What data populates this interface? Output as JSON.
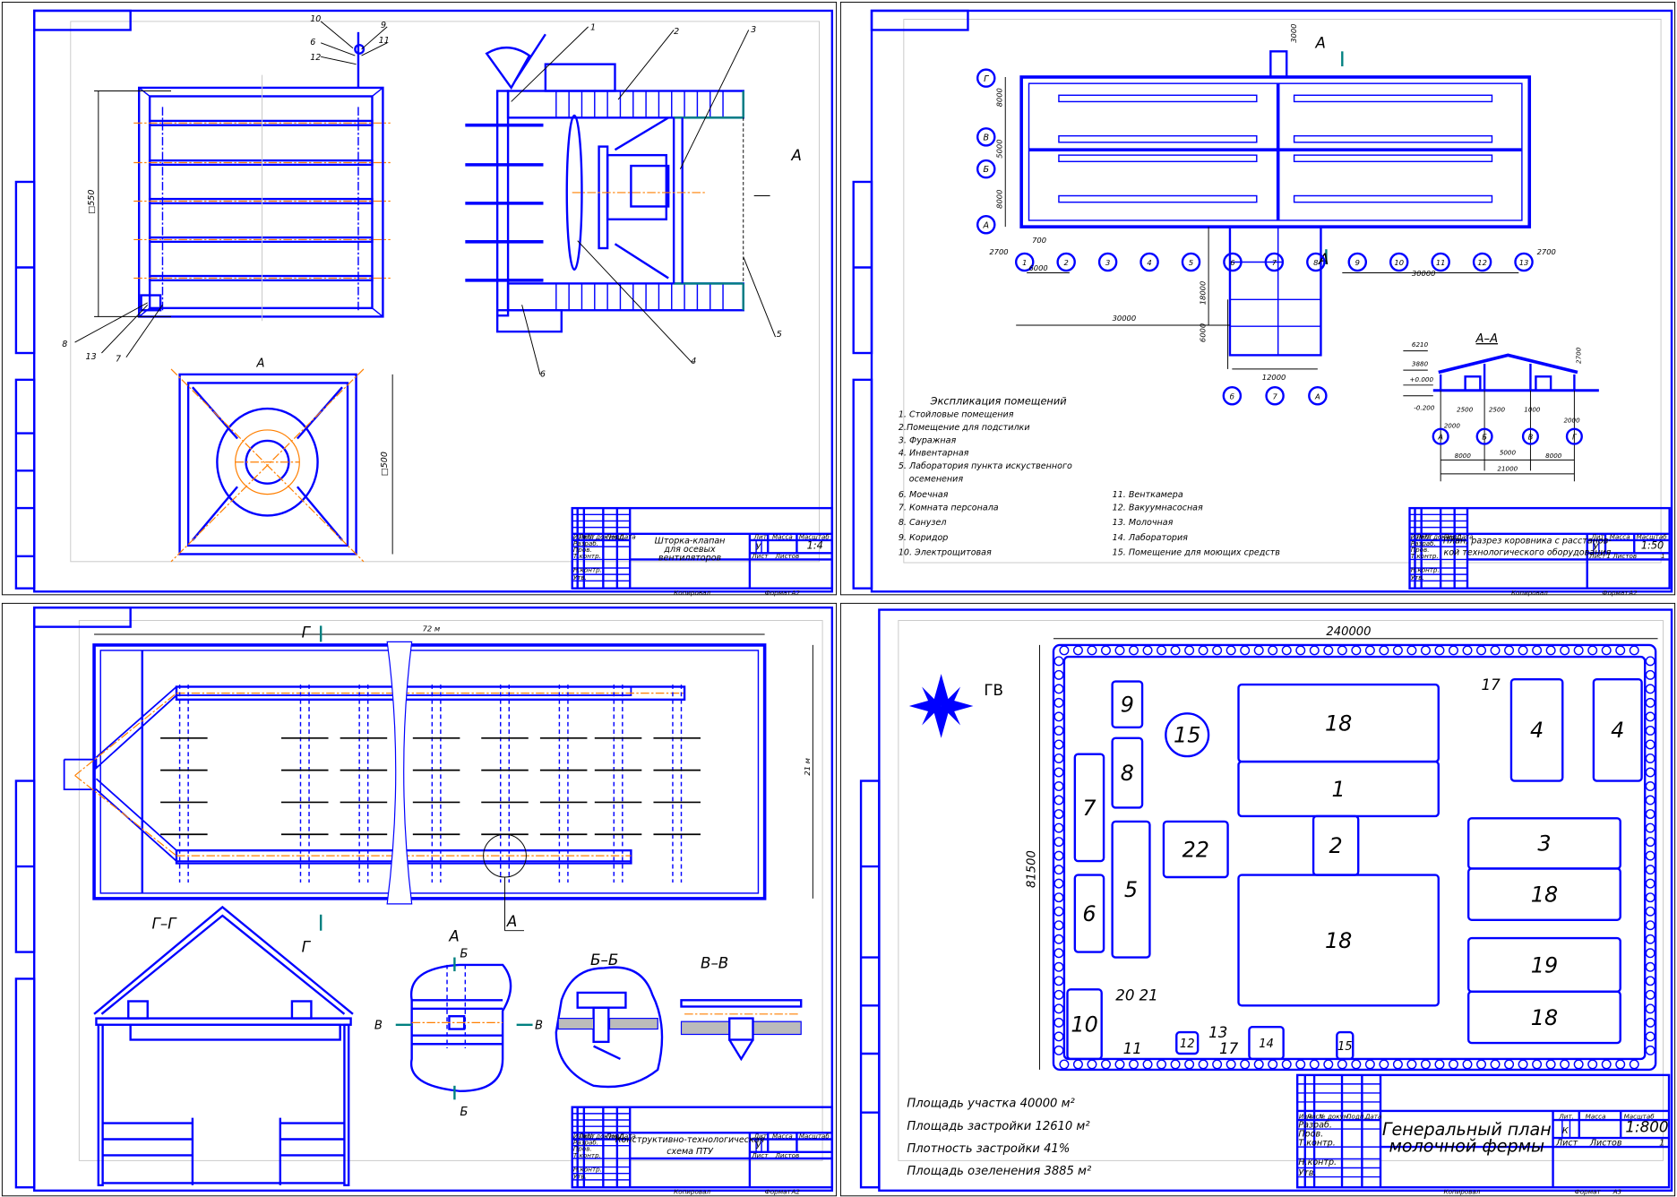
{
  "title_block_labels": {
    "izm": "Изм",
    "list": "Лист",
    "doc_no": "№ докум.",
    "sign": "Подп.",
    "date": "Дата",
    "developed": "Разраб.",
    "checked": "Пров.",
    "t_control": "Т.контр.",
    "n_control": "Н.контр.",
    "approved": "Утв.",
    "lit": "Лит.",
    "mass": "Масса",
    "scale": "Масштаб",
    "sheet": "Лист",
    "sheets": "Листов",
    "copied": "Копировал",
    "format": "Формат"
  },
  "sheets": [
    {
      "title": [
        "Шторка-клапан",
        "для осевых",
        "вентиляторов"
      ],
      "scale": "1:4",
      "lit": "У",
      "format": "А2",
      "dimension_labels": [
        "□550",
        "□500"
      ],
      "view_label": "А",
      "callouts": [
        "1",
        "2",
        "3",
        "4",
        "5",
        "6",
        "6",
        "7",
        "8",
        "9",
        "10",
        "11",
        "12",
        "13"
      ]
    },
    {
      "title": [
        "План, разрез коровника с расстанов-",
        "кой технологического оборудования"
      ],
      "scale": "1:50",
      "lit": "У",
      "sheet_no": "1",
      "sheets_total": "1",
      "format": "А2",
      "section_mark": "А",
      "grid_rows": [
        "Г",
        "В",
        "Б",
        "А"
      ],
      "grid_cols": [
        "1",
        "2",
        "3",
        "4",
        "5",
        "6",
        "7",
        "8",
        "9",
        "10",
        "11",
        "12",
        "13"
      ],
      "annex_axes": [
        "б",
        "7",
        "А"
      ],
      "dimensions": [
        "3000",
        "8000",
        "5000",
        "8000",
        "2700",
        "6000",
        "30000",
        "18000",
        "6000",
        "12000",
        "30000",
        "2700",
        "700"
      ],
      "explication": {
        "title": "Экспликация помещений",
        "left": [
          "1. Стойловые помещения",
          "2.Помещение для подстилки",
          "3. Фуражная",
          "4. Инвентарная",
          "5. Лаборатория пункта искуственного",
          "осеменения",
          "6. Моечная",
          "7. Комната персонала",
          "8. Санузел",
          "9. Коридор",
          "10. Электрощитовая"
        ],
        "right": [
          "11. Венткамера",
          "12. Вакуумнасосная",
          "13. Молочная",
          "14. Лаборатория",
          "15. Помещение для моющих средств"
        ]
      },
      "section_aa": {
        "title": "А–А",
        "levels": [
          "6210",
          "3880",
          "+0.000",
          "-0.200"
        ],
        "dimensions": [
          "2700",
          "2500",
          "2500",
          "1000",
          "2000",
          "2000",
          "8000",
          "5000",
          "8000",
          "21000"
        ],
        "axes": [
          "А",
          "Б",
          "В",
          "Г"
        ]
      }
    },
    {
      "title": [
        "Конструктивно-технологическая",
        "схема ПТУ"
      ],
      "lit": "У",
      "format": "А2",
      "dimensions": [
        "72 м",
        "21 м"
      ],
      "section_labels": [
        "Г",
        "Г",
        "Г–Г",
        "А",
        "А",
        "Б",
        "Б",
        "Б–Б",
        "В",
        "В",
        "В–В"
      ]
    },
    {
      "title": [
        "Генеральный план",
        "молочной фермы"
      ],
      "scale": "1:800",
      "lit": "К",
      "sheets_total": "1",
      "format": "А3",
      "dimensions": [
        "240000",
        "81500"
      ],
      "compass_label": "ГВ",
      "buildings": [
        "18",
        "1",
        "2",
        "18",
        "3",
        "18",
        "19",
        "18",
        "4",
        "4",
        "9",
        "8",
        "7",
        "5",
        "6",
        "22",
        "15",
        "10",
        "20",
        "21",
        "11",
        "12",
        "13",
        "14",
        "15",
        "17",
        "17"
      ],
      "stats": [
        "Площадь участка 40000 м²",
        "Площадь застройки 12610 м²",
        "Плотность застройки 41%",
        "Площадь озеленения 3885 м²"
      ]
    }
  ],
  "colors": {
    "lines": "#0000ff",
    "axis": "#ff7f00",
    "section_marks": "#008080"
  }
}
